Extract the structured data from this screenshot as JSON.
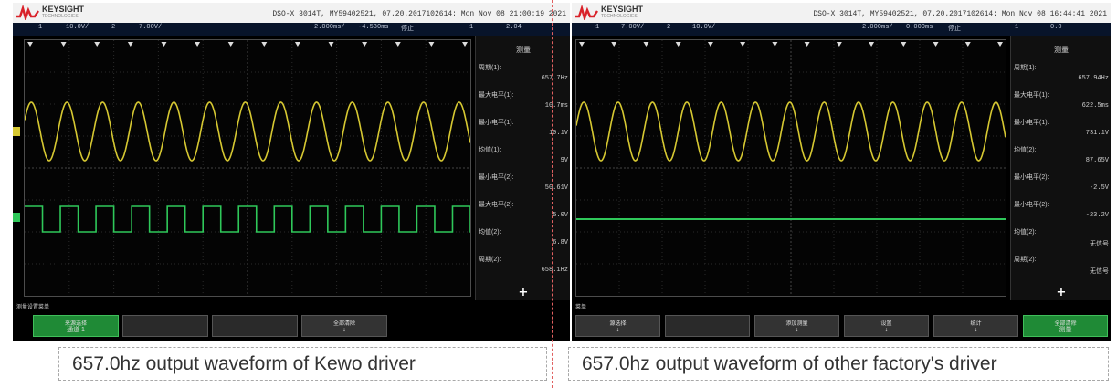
{
  "brand": {
    "name": "KEYSIGHT",
    "sub": "TECHNOLOGIES"
  },
  "colors": {
    "ch1": "#d6c832",
    "ch2": "#2fc85a",
    "softkey_on": "#1f8a36"
  },
  "left": {
    "header_info": "DSO-X 3014T, MY59402521, 07.20.2017102614: Mon Nov 08 21:00:19 2021",
    "topbar": [
      "1",
      "10.0V/",
      "2",
      "7.00V/",
      "",
      "2.000ms/",
      "-4.530ms",
      "停止",
      "",
      "1",
      "2.04"
    ],
    "side_title": "测量",
    "measurements": [
      {
        "label": "周期(1):",
        "value": "657.7Hz"
      },
      {
        "label": "最大电平(1):",
        "value": "10.7ms"
      },
      {
        "label": "最小电平(1):",
        "value": "10.1V"
      },
      {
        "label": "均值(1):",
        "value": "9V"
      },
      {
        "label": "最小电平(2):",
        "value": "50.61V"
      },
      {
        "label": "最大电平(2):",
        "value": "5.0V"
      },
      {
        "label": "均值(2):",
        "value": "6.8V"
      },
      {
        "label": "周期(2):",
        "value": "658.1Hz"
      }
    ],
    "plus": "+",
    "softkey_title": "测量设置菜单",
    "softkeys": [
      {
        "title": "来源选择",
        "sub": "通道 1",
        "on": true
      },
      {
        "title": "",
        "sub": "",
        "on": false
      },
      {
        "title": "",
        "sub": "",
        "on": false
      },
      {
        "title": "全部清除",
        "sub": "↓",
        "on": false
      }
    ],
    "caption": "657.0hz output waveform of Kewo driver"
  },
  "right": {
    "header_info": "DSO-X 3014T, MY59402521, 07.20.2017102614: Mon Nov 08 16:44:41 2021",
    "topbar": [
      "1",
      "7.00V/",
      "2",
      "10.0V/",
      "",
      "2.000ms/",
      "0.000ms",
      "停止",
      "",
      "1",
      "0.0"
    ],
    "side_title": "测量",
    "measurements": [
      {
        "label": "周期(1):",
        "value": "657.94Hz"
      },
      {
        "label": "最大电平(1):",
        "value": "622.5ms"
      },
      {
        "label": "最小电平(1):",
        "value": "731.1V"
      },
      {
        "label": "均值(2):",
        "value": "87.65V"
      },
      {
        "label": "最小电平(2):",
        "value": "-2.5V"
      },
      {
        "label": "最小电平(2):",
        "value": "-23.2V"
      },
      {
        "label": "均值(2):",
        "value": "无信号"
      },
      {
        "label": "周期(2):",
        "value": "无信号"
      }
    ],
    "plus": "+",
    "softkey_title": "菜单",
    "softkeys": [
      {
        "title": "源选择",
        "sub": "↓",
        "on": false
      },
      {
        "title": "",
        "sub": "",
        "on": false
      },
      {
        "title": "添加测量",
        "sub": "↓",
        "on": false
      },
      {
        "title": "设置",
        "sub": "↓",
        "on": false
      },
      {
        "title": "统计",
        "sub": "↓",
        "on": false
      },
      {
        "title": "全部清除",
        "sub": "测量",
        "on": true
      }
    ],
    "caption": "657.0hz output waveform of other factory's driver"
  }
}
